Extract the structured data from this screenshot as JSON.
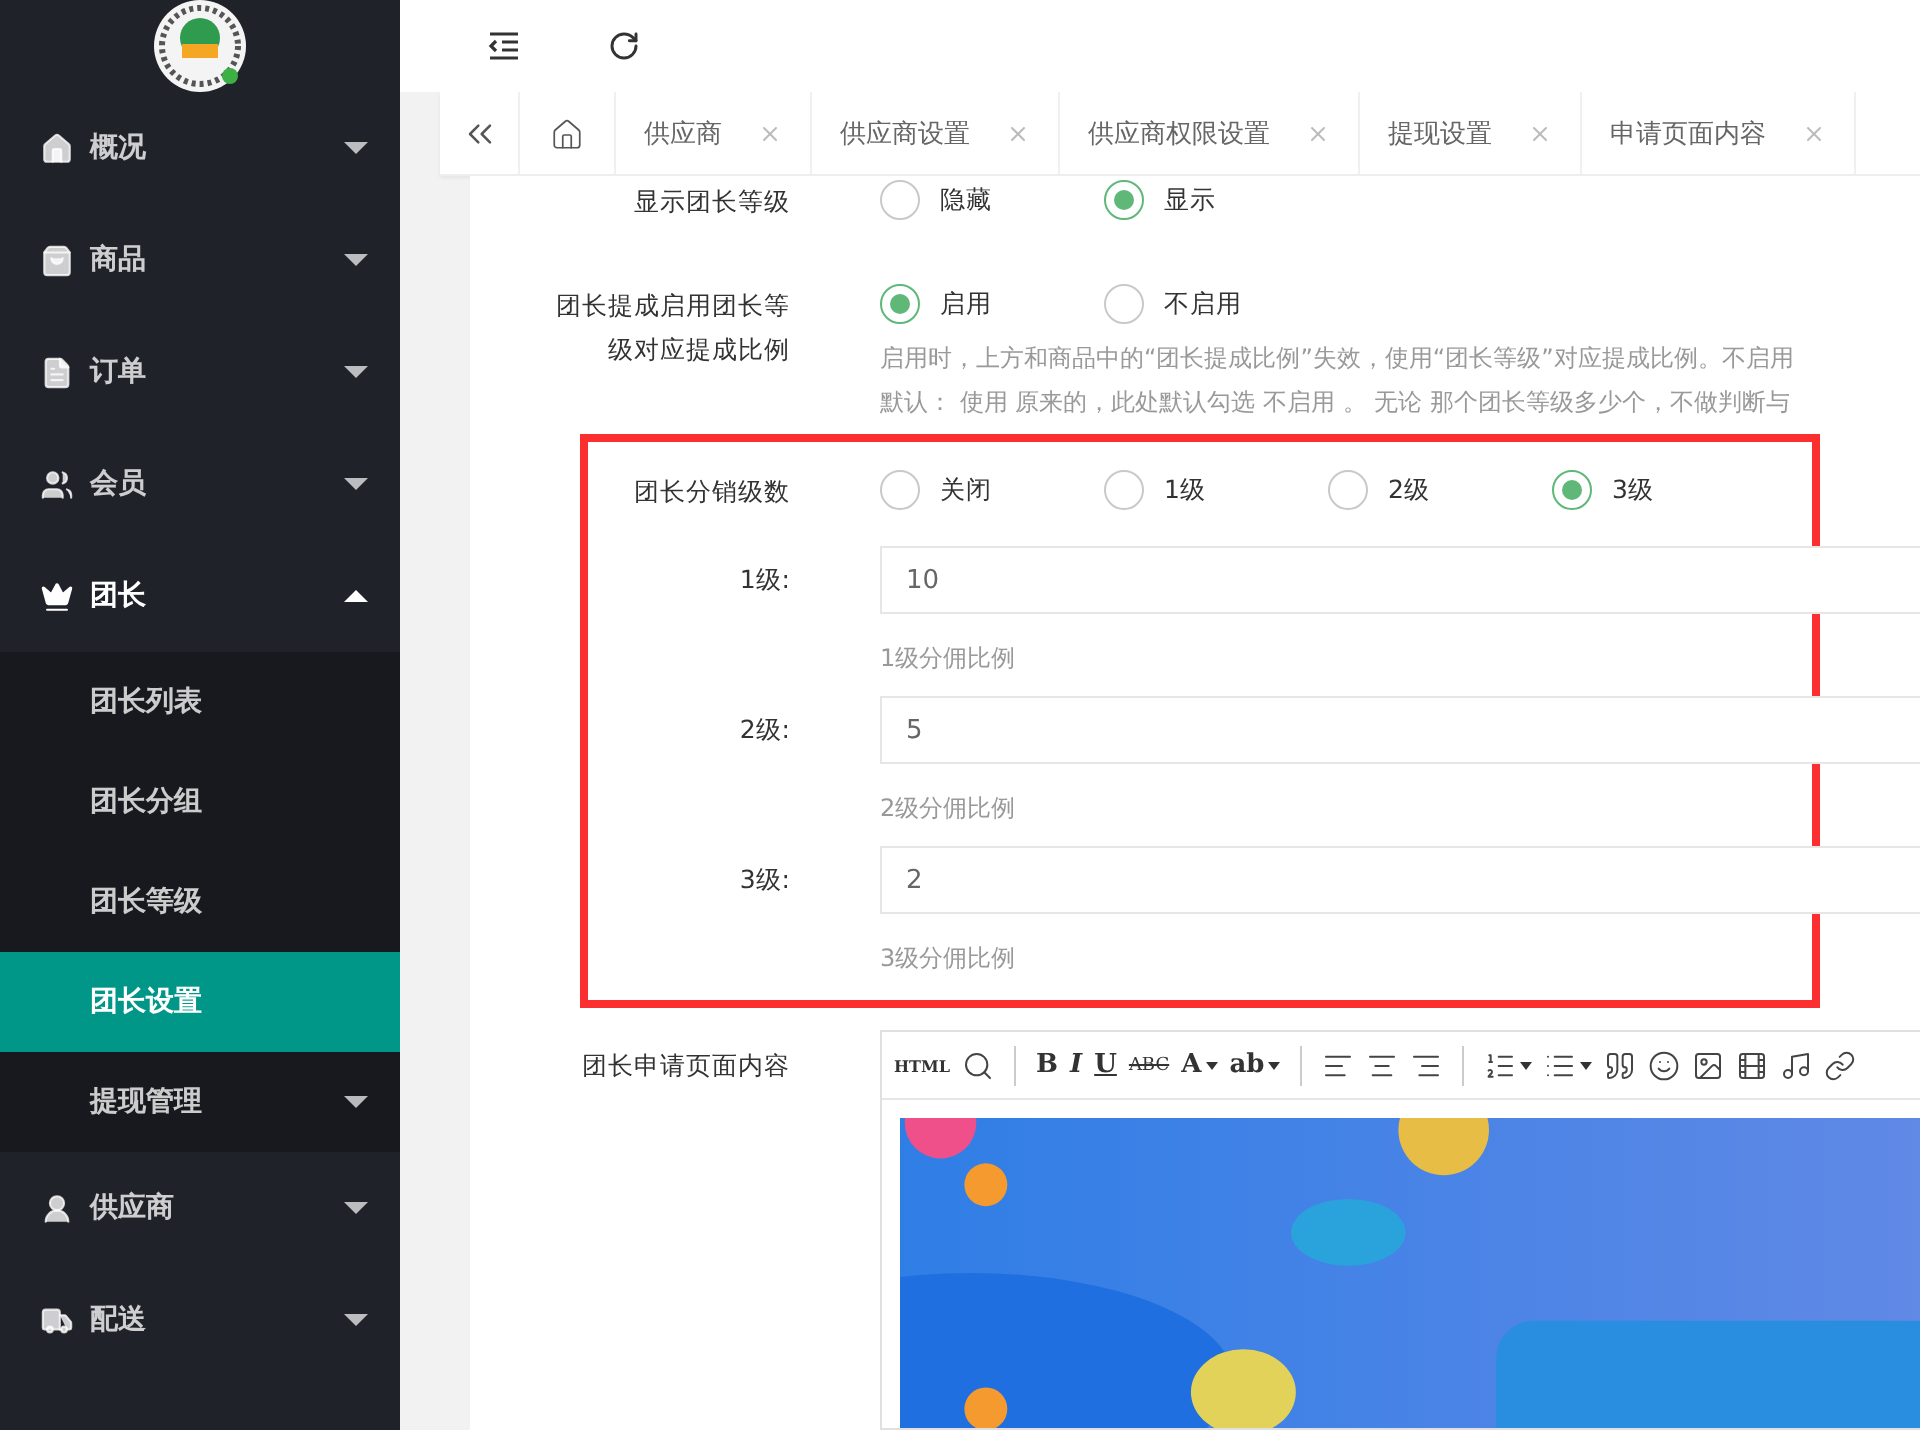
{
  "sidebar": {
    "menu": [
      {
        "label": "概况",
        "expanded": false
      },
      {
        "label": "商品",
        "expanded": false
      },
      {
        "label": "订单",
        "expanded": false
      },
      {
        "label": "会员",
        "expanded": false
      },
      {
        "label": "团长",
        "expanded": true,
        "children": [
          {
            "label": "团长列表",
            "selected": false
          },
          {
            "label": "团长分组",
            "selected": false
          },
          {
            "label": "团长等级",
            "selected": false
          },
          {
            "label": "团长设置",
            "selected": true
          },
          {
            "label": "提现管理",
            "selected": false,
            "expanded": false
          }
        ]
      },
      {
        "label": "供应商",
        "expanded": false
      },
      {
        "label": "配送",
        "expanded": false
      }
    ]
  },
  "tabs": [
    {
      "label": "供应商"
    },
    {
      "label": "供应商设置"
    },
    {
      "label": "供应商权限设置"
    },
    {
      "label": "提现设置"
    },
    {
      "label": "申请页面内容"
    }
  ],
  "form": {
    "rows": [
      {
        "kind": "radio",
        "label": "显示团长等级",
        "options": [
          {
            "label": "隐藏",
            "selected": false
          },
          {
            "label": "显示",
            "selected": true
          }
        ]
      },
      {
        "kind": "radio",
        "label": "团长提成启用团长等级对应提成比例",
        "options": [
          {
            "label": "启用",
            "selected": true
          },
          {
            "label": "不启用",
            "selected": false
          }
        ],
        "help": [
          "启用时，上方和商品中的“团长提成比例”失效，使用“团长等级”对应提成比例。不启用",
          "默认： 使用 原来的，此处默认勾选 不启用 。 无论 那个团长等级多少个，不做判断与"
        ]
      }
    ],
    "highlighted_rows": [
      {
        "kind": "radio",
        "label": "团长分销级数",
        "options": [
          {
            "label": "关闭",
            "selected": false
          },
          {
            "label": "1级",
            "selected": false
          },
          {
            "label": "2级",
            "selected": false
          },
          {
            "label": "3级",
            "selected": true
          }
        ]
      },
      {
        "kind": "input",
        "label": "1级:",
        "value": "10",
        "help": [
          "1级分佣比例"
        ]
      },
      {
        "kind": "input",
        "label": "2级:",
        "value": "5",
        "help": [
          "2级分佣比例"
        ]
      },
      {
        "kind": "input",
        "label": "3级:",
        "value": "2",
        "help": [
          "3级分佣比例"
        ]
      }
    ],
    "editor": {
      "label": "团长申请页面内容",
      "toolbar": [
        {
          "kind": "text",
          "label": "HTML"
        },
        {
          "kind": "icon"
        },
        {
          "kind": "sep"
        },
        {
          "kind": "text",
          "label": "B"
        },
        {
          "kind": "text",
          "label": "I"
        },
        {
          "kind": "text",
          "label": "U"
        },
        {
          "kind": "text",
          "label": "ABC"
        },
        {
          "kind": "text",
          "label": "A"
        },
        {
          "kind": "text",
          "label": "ab"
        },
        {
          "kind": "sep"
        },
        {
          "kind": "icon"
        },
        {
          "kind": "icon"
        },
        {
          "kind": "icon"
        },
        {
          "kind": "sep"
        },
        {
          "kind": "icon"
        },
        {
          "kind": "icon"
        },
        {
          "kind": "icon"
        },
        {
          "kind": "icon"
        },
        {
          "kind": "icon"
        },
        {
          "kind": "icon"
        },
        {
          "kind": "icon"
        },
        {
          "kind": "icon"
        }
      ]
    }
  }
}
